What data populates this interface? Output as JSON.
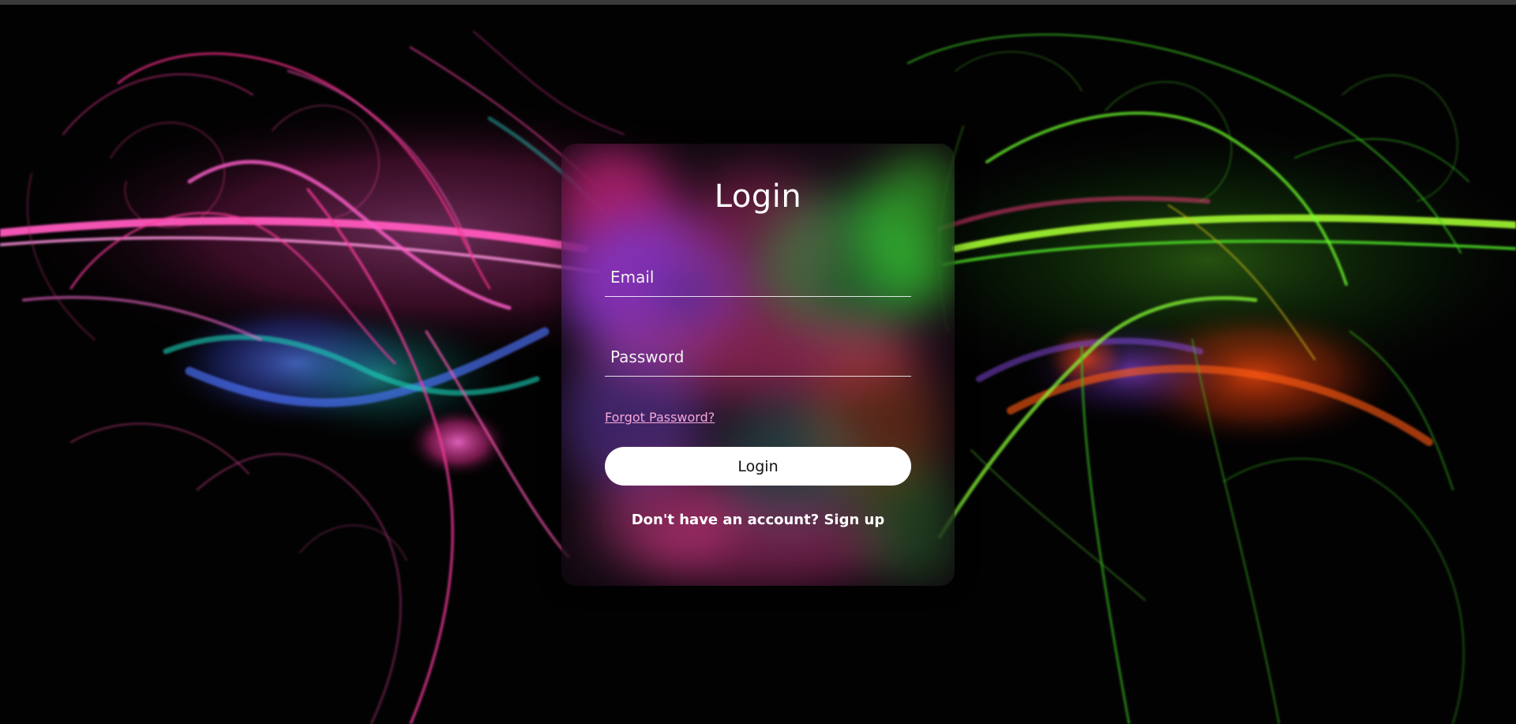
{
  "login_card": {
    "title": "Login",
    "email_placeholder": "Email",
    "password_placeholder": "Password",
    "forgot_password_label": "Forgot Password?",
    "login_button_label": "Login",
    "signup_prompt": "Don't have an account?",
    "signup_link_label": "Sign up"
  },
  "colors": {
    "background": "#030203",
    "card_tint": "rgba(20,10,18,0.55)",
    "link": "#f7a7d8",
    "button_background": "#ffffff",
    "button_text": "#111111",
    "text": "#ffffff",
    "pink": "#ff4fb5",
    "magenta": "#e046ff",
    "blue": "#4a6cff",
    "teal": "#13b9a8",
    "green": "#4cff2d",
    "orange": "#ff5a10",
    "yellow": "#d9b11a"
  }
}
